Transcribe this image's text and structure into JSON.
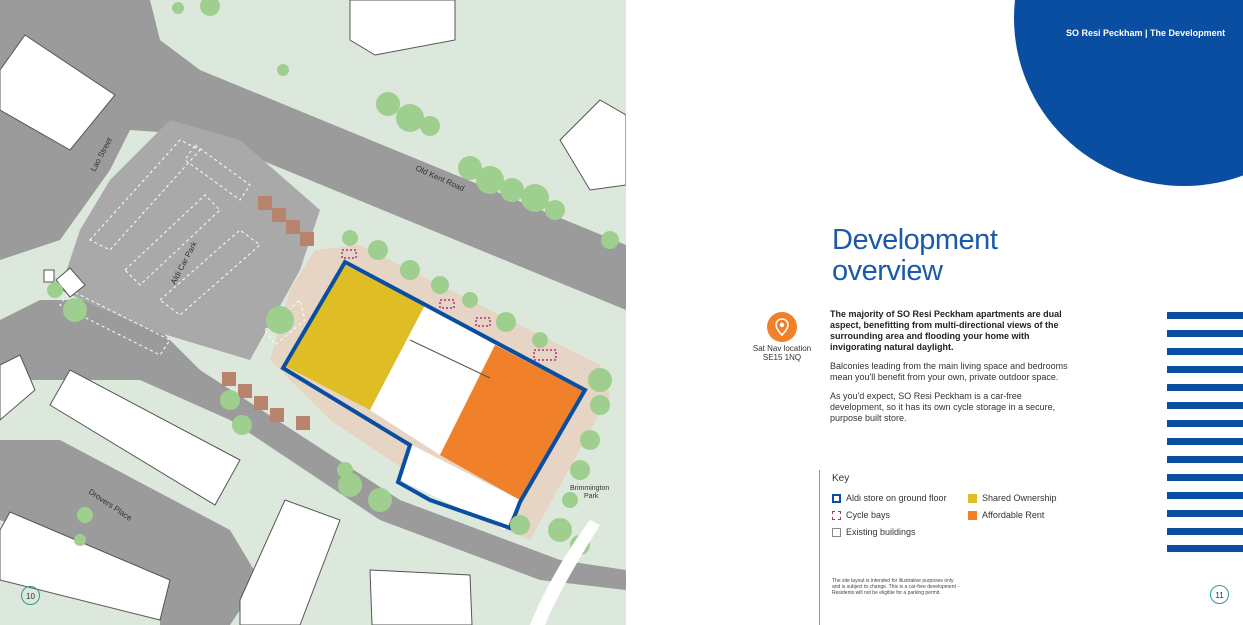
{
  "header": {
    "label": "SO Resi Peckham | The Development"
  },
  "title": {
    "line1": "Development",
    "line2": "overview"
  },
  "satnav": {
    "line1": "Sat Nav location",
    "line2": "SE15 1NQ",
    "icon": "location-pin-icon"
  },
  "body": {
    "intro": "The majority of SO Resi Peckham apartments are dual aspect, benefitting from multi-directional views of the surrounding area and flooding your home with invigorating natural daylight.",
    "balconies": "Balconies leading from the main living space and bedrooms mean you'll benefit from your own, private outdoor space.",
    "carfree": "As you'd expect, SO Resi Peckham is a car-free development, so it has its own cycle storage in a secure, purpose built store."
  },
  "key": {
    "title": "Key",
    "items": [
      {
        "label": "Aldi store on ground floor"
      },
      {
        "label": "Cycle bays"
      },
      {
        "label": "Existing buildings"
      },
      {
        "label": "Shared Ownership"
      },
      {
        "label": "Affordable Rent"
      }
    ]
  },
  "disclaimer": {
    "line1": "The site layout is intended for illustrative purposes only",
    "line2": "and is subject to change. This is a car-free development -",
    "line3": "Residents will not be eligible for a parking permit."
  },
  "map": {
    "streets": [
      "Lao Street",
      "Old Kent Road",
      "Aldi Car Park",
      "Drovers Place",
      "Brimmington Park"
    ]
  },
  "pages": {
    "left": "10",
    "right": "11"
  },
  "colors": {
    "brand_blue": "#0a4ea1",
    "title_blue": "#1a5aa8",
    "shared_ownership": "#dfbe25",
    "affordable_rent": "#f0812a",
    "cycle_bays": "#b0307a",
    "map_green": "#dde8dc",
    "road_grey": "#9b9b9b",
    "tree_green": "#9fcf8f"
  }
}
